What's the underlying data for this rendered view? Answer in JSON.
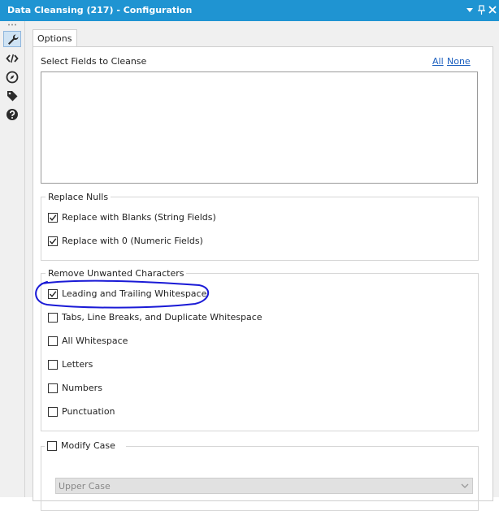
{
  "window": {
    "title": "Data Cleansing (217) - Configuration",
    "controls": [
      "pin-down-icon",
      "pin-icon",
      "close-icon"
    ]
  },
  "sidebar": {
    "items": [
      {
        "icon": "wrench-icon",
        "active": true
      },
      {
        "icon": "code-icon",
        "active": false
      },
      {
        "icon": "compass-icon",
        "active": false
      },
      {
        "icon": "tag-icon",
        "active": false
      },
      {
        "icon": "help-icon",
        "active": false
      }
    ]
  },
  "tabs": [
    {
      "label": "Options"
    }
  ],
  "fields": {
    "label": "Select Fields to Cleanse",
    "all_link": "All",
    "none_link": "None",
    "items": []
  },
  "replace_nulls": {
    "legend": "Replace Nulls",
    "options": [
      {
        "label": "Replace with Blanks (String Fields)",
        "checked": true
      },
      {
        "label": "Replace with 0 (Numeric Fields)",
        "checked": true
      }
    ]
  },
  "remove_chars": {
    "legend": "Remove Unwanted Characters",
    "options": [
      {
        "label": "Leading and Trailing Whitespace",
        "checked": true
      },
      {
        "label": "Tabs, Line Breaks, and Duplicate Whitespace",
        "checked": false
      },
      {
        "label": "All Whitespace",
        "checked": false
      },
      {
        "label": "Letters",
        "checked": false
      },
      {
        "label": "Numbers",
        "checked": false
      },
      {
        "label": "Punctuation",
        "checked": false
      }
    ]
  },
  "modify_case": {
    "label": "Modify Case",
    "checked": false,
    "selected": "Upper Case"
  },
  "annotation_color": "#1a1ad6"
}
